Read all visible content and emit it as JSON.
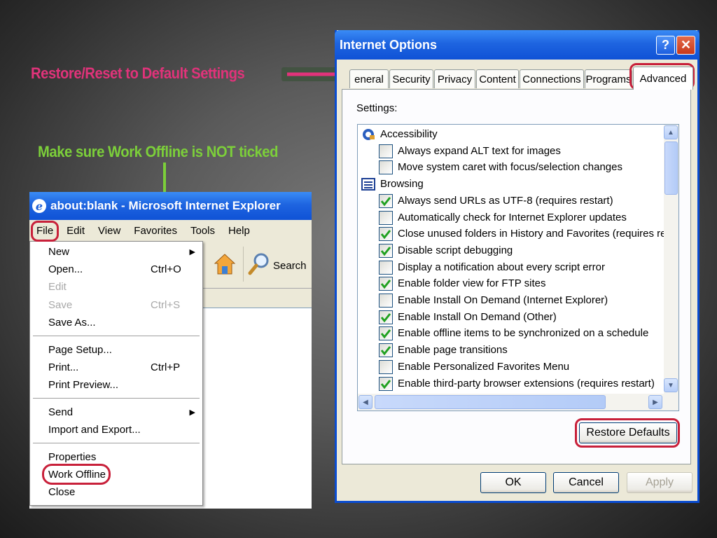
{
  "annotations": {
    "restore_text": "Restore/Reset to Default Settings",
    "offline_text": "Make sure Work Offline is NOT ticked",
    "restore_color": "#e0337a",
    "offline_color": "#7ccf3a"
  },
  "ie_window": {
    "title": "about:blank - Microsoft Internet Explorer",
    "menu": [
      "File",
      "Edit",
      "View",
      "Favorites",
      "Tools",
      "Help"
    ],
    "toolbar": {
      "search_label": "Search",
      "icons": [
        "back-icon",
        "home-icon",
        "search-icon"
      ]
    },
    "file_menu": {
      "items": [
        {
          "label": "New",
          "shortcut": "",
          "submenu": true,
          "disabled": false
        },
        {
          "label": "Open...",
          "shortcut": "Ctrl+O",
          "submenu": false,
          "disabled": false
        },
        {
          "label": "Edit",
          "shortcut": "",
          "submenu": false,
          "disabled": true
        },
        {
          "label": "Save",
          "shortcut": "Ctrl+S",
          "submenu": false,
          "disabled": true
        },
        {
          "label": "Save As...",
          "shortcut": "",
          "submenu": false,
          "disabled": false
        },
        {
          "label": "Page Setup...",
          "shortcut": "",
          "submenu": false,
          "disabled": false
        },
        {
          "label": "Print...",
          "shortcut": "Ctrl+P",
          "submenu": false,
          "disabled": false
        },
        {
          "label": "Print Preview...",
          "shortcut": "",
          "submenu": false,
          "disabled": false
        },
        {
          "label": "Send",
          "shortcut": "",
          "submenu": true,
          "disabled": false
        },
        {
          "label": "Import and Export...",
          "shortcut": "",
          "submenu": false,
          "disabled": false
        },
        {
          "label": "Properties",
          "shortcut": "",
          "submenu": false,
          "disabled": false
        },
        {
          "label": "Work Offline",
          "shortcut": "",
          "submenu": false,
          "disabled": false
        },
        {
          "label": "Close",
          "shortcut": "",
          "submenu": false,
          "disabled": false
        }
      ]
    }
  },
  "dialog": {
    "title": "Internet Options",
    "help_glyph": "?",
    "close_glyph": "✕",
    "tabs": [
      "eneral",
      "Security",
      "Privacy",
      "Content",
      "Connections",
      "Programs",
      "Advanced"
    ],
    "active_tab": "Advanced",
    "settings_label": "Settings:",
    "rows": [
      {
        "kind": "category",
        "label": "Accessibility",
        "icon": "accessibility-icon"
      },
      {
        "kind": "option",
        "label": "Always expand ALT text for images",
        "checked": false
      },
      {
        "kind": "option",
        "label": "Move system caret with focus/selection changes",
        "checked": false
      },
      {
        "kind": "category",
        "label": "Browsing",
        "icon": "browsing-icon"
      },
      {
        "kind": "option",
        "label": "Always send URLs as UTF-8 (requires restart)",
        "checked": true
      },
      {
        "kind": "option",
        "label": "Automatically check for Internet Explorer updates",
        "checked": false
      },
      {
        "kind": "option",
        "label": "Close unused folders in History and Favorites (requires restart)",
        "checked": true
      },
      {
        "kind": "option",
        "label": "Disable script debugging",
        "checked": true
      },
      {
        "kind": "option",
        "label": "Display a notification about every script error",
        "checked": false
      },
      {
        "kind": "option",
        "label": "Enable folder view for FTP sites",
        "checked": true
      },
      {
        "kind": "option",
        "label": "Enable Install On Demand (Internet Explorer)",
        "checked": false
      },
      {
        "kind": "option",
        "label": "Enable Install On Demand (Other)",
        "checked": true
      },
      {
        "kind": "option",
        "label": "Enable offline items to be synchronized on a schedule",
        "checked": true
      },
      {
        "kind": "option",
        "label": "Enable page transitions",
        "checked": true
      },
      {
        "kind": "option",
        "label": "Enable Personalized Favorites Menu",
        "checked": false
      },
      {
        "kind": "option",
        "label": "Enable third-party browser extensions (requires restart)",
        "checked": true
      }
    ],
    "restore_button": "Restore Defaults",
    "ok_button": "OK",
    "cancel_button": "Cancel",
    "apply_button": "Apply",
    "check_color": "#21a121",
    "highlight_ring_color": "#c8203a"
  }
}
